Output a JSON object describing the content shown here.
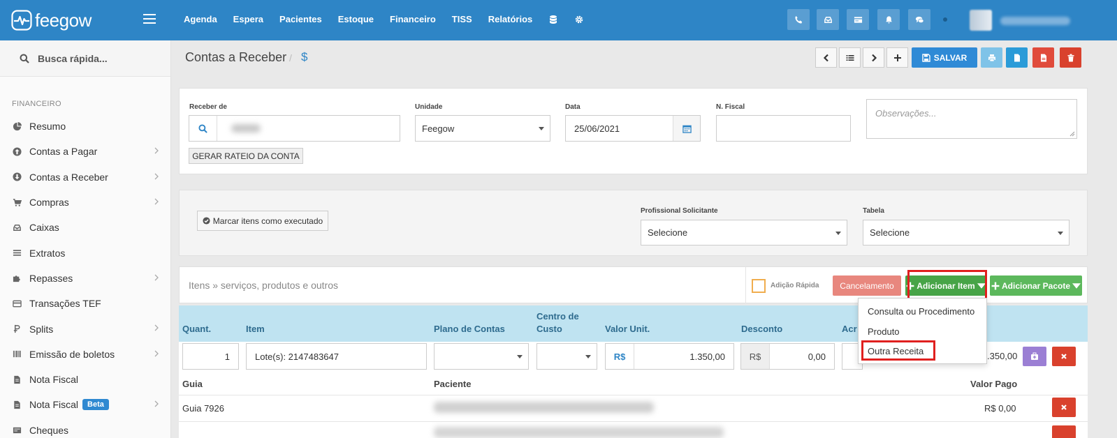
{
  "app": {
    "logo_text": "feegow",
    "brand_color": "#2e85c6"
  },
  "topnav": {
    "items": [
      "Agenda",
      "Espera",
      "Pacientes",
      "Estoque",
      "Financeiro",
      "TISS",
      "Relatórios"
    ],
    "icons": [
      "phone-icon",
      "inbox-icon",
      "card-icon",
      "bell-icon",
      "chat-icon"
    ]
  },
  "sidebar": {
    "search_label": "Busca rápida...",
    "section": "FINANCEIRO",
    "items": [
      {
        "label": "Resumo",
        "icon": "pie-chart-icon",
        "has_submenu": false
      },
      {
        "label": "Contas a Pagar",
        "icon": "arrow-up-circle-icon",
        "has_submenu": true
      },
      {
        "label": "Contas a Receber",
        "icon": "arrow-down-circle-icon",
        "has_submenu": true
      },
      {
        "label": "Compras",
        "icon": "cart-icon",
        "has_submenu": true
      },
      {
        "label": "Caixas",
        "icon": "inbox-icon",
        "has_submenu": false
      },
      {
        "label": "Extratos",
        "icon": "list-icon",
        "has_submenu": false
      },
      {
        "label": "Repasses",
        "icon": "puzzle-icon",
        "has_submenu": true
      },
      {
        "label": "Transações TEF",
        "icon": "card-icon",
        "has_submenu": false
      },
      {
        "label": "Splits",
        "icon": "split-icon",
        "has_submenu": true
      },
      {
        "label": "Emissão de boletos",
        "icon": "barcode-icon",
        "has_submenu": true
      },
      {
        "label": "Nota Fiscal",
        "icon": "file-icon",
        "has_submenu": false
      },
      {
        "label": "Nota Fiscal",
        "icon": "file-icon",
        "has_submenu": true,
        "badge": "Beta"
      },
      {
        "label": "Cheques",
        "icon": "cheque-icon",
        "has_submenu": false
      }
    ]
  },
  "header": {
    "title": "Contas a Receber",
    "separator": "/",
    "sub": "$",
    "save_label": "SALVAR"
  },
  "form": {
    "receber_de_label": "Receber de",
    "unidade_label": "Unidade",
    "unidade_value": "Feegow",
    "data_label": "Data",
    "data_value": "25/06/2021",
    "nfiscal_label": "N. Fiscal",
    "obs_placeholder": "Observações...",
    "rateio_button": "GERAR RATEIO DA CONTA"
  },
  "exec": {
    "mark_button": "Marcar itens como executado",
    "prof_label": "Profissional Solicitante",
    "prof_value": "Selecione",
    "tabela_label": "Tabela",
    "tabela_value": "Selecione"
  },
  "items": {
    "title": "Itens » serviços, produtos e outros",
    "quick_add": "Adição Rápida",
    "cancel_button": "Cancelamento",
    "add_item_button": "Adicionar Item",
    "add_pack_button": "Adicionar Pacote",
    "dropdown": [
      "Consulta ou Procedimento",
      "Produto",
      "Outra Receita"
    ],
    "columns": {
      "quant": "Quant.",
      "item": "Item",
      "plano": "Plano de Contas",
      "centro_1": "Centro de",
      "centro_2": "Custo",
      "valor_unit": "Valor Unit.",
      "desconto": "Desconto",
      "acrescimo_partial": "Acr"
    },
    "row": {
      "quant": "1",
      "item": "Lote(s): 2147483647",
      "currency": "R$",
      "valor_unit": "1.350,00",
      "desconto": "0,00",
      "total_partial": ".350,00"
    },
    "sub_columns": {
      "guia": "Guia",
      "paciente": "Paciente",
      "valor_pago": "Valor Pago"
    },
    "sub_row": {
      "guia": "Guia 7926",
      "valor_pago": "R$ 0,00"
    }
  }
}
